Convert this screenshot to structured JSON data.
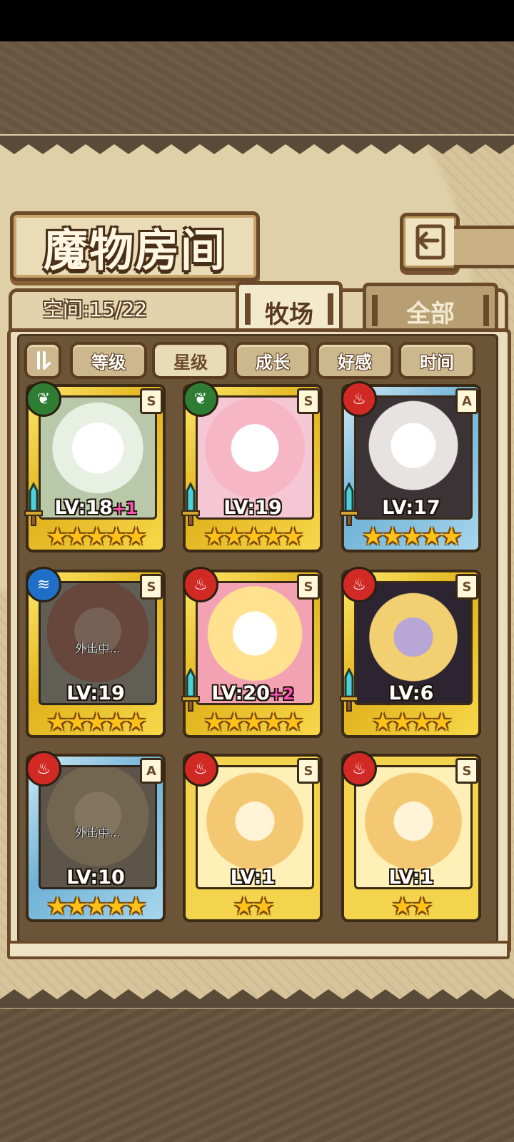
{
  "header": {
    "title": "魔物房间",
    "back_icon": "return-arrow-icon"
  },
  "tabs": {
    "space_label": "空间:15/22",
    "active": "牧场",
    "other": "全部"
  },
  "sort": {
    "toggle_icon": "sort-order-icon",
    "options": [
      "等级",
      "星级",
      "成长",
      "好感",
      "时间"
    ],
    "selected": "星级"
  },
  "monsters": [
    {
      "element": "nature",
      "rank": "S",
      "level": "LV:18",
      "bonus": "+1",
      "stars": 5,
      "away": ""
    },
    {
      "element": "nature",
      "rank": "S",
      "level": "LV:19",
      "bonus": "",
      "stars": 5,
      "away": ""
    },
    {
      "element": "fire",
      "rank": "A",
      "level": "LV:17",
      "bonus": "",
      "stars": 5,
      "away": ""
    },
    {
      "element": "water",
      "rank": "S",
      "level": "LV:19",
      "bonus": "",
      "stars": 5,
      "away": "外出中..."
    },
    {
      "element": "fire",
      "rank": "S",
      "level": "LV:20",
      "bonus": "+2",
      "stars": 5,
      "away": ""
    },
    {
      "element": "fire",
      "rank": "S",
      "level": "LV:6",
      "bonus": "",
      "stars": 4,
      "away": ""
    },
    {
      "element": "fire",
      "rank": "A",
      "level": "LV:10",
      "bonus": "",
      "stars": 5,
      "away": "外出中..."
    },
    {
      "element": "fire",
      "rank": "S",
      "level": "LV:1",
      "bonus": "",
      "stars": 2,
      "away": ""
    },
    {
      "element": "fire",
      "rank": "S",
      "level": "LV:1",
      "bonus": "",
      "stars": 2,
      "away": ""
    }
  ],
  "colors": {
    "frame_brown": "#6b4a2a",
    "star_gold": "#ffc21a",
    "fire": "#d12a25",
    "nature": "#2e7d32",
    "water": "#1f6ec8",
    "bonus_pink": "#ff52b9"
  }
}
